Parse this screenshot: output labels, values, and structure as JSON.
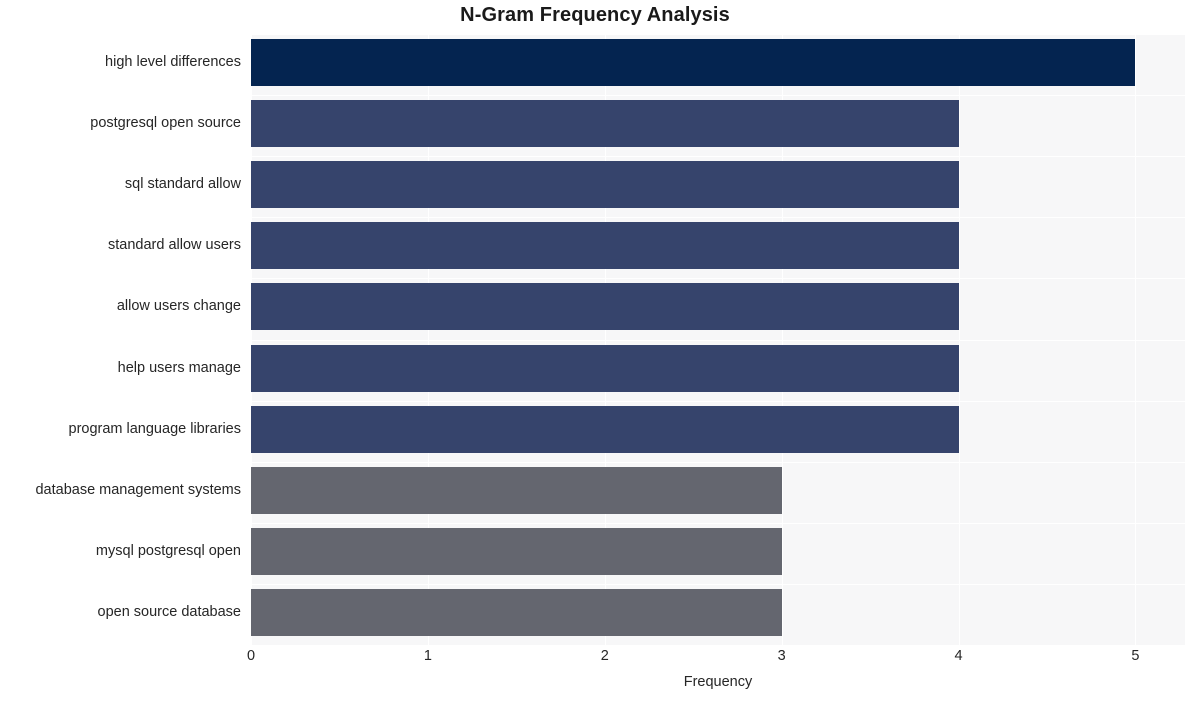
{
  "chart_data": {
    "type": "bar",
    "orientation": "horizontal",
    "title": "N-Gram Frequency Analysis",
    "xlabel": "Frequency",
    "ylabel": "",
    "categories": [
      "high level differences",
      "postgresql open source",
      "sql standard allow",
      "standard allow users",
      "allow users change",
      "help users manage",
      "program language libraries",
      "database management systems",
      "mysql postgresql open",
      "open source database"
    ],
    "values": [
      5,
      4,
      4,
      4,
      4,
      4,
      4,
      3,
      3,
      3
    ],
    "bar_colors": [
      "#042450",
      "#36446c",
      "#36446c",
      "#36446c",
      "#36446c",
      "#36446c",
      "#36446c",
      "#64666f",
      "#64666f",
      "#64666f"
    ],
    "xticks": [
      "0",
      "1",
      "2",
      "3",
      "4",
      "5"
    ],
    "xtick_values": [
      0,
      1,
      2,
      3,
      4,
      5
    ],
    "xlim": [
      0,
      5.28
    ],
    "grid": true,
    "grid_color": "#ffffff",
    "legend": null,
    "plot_background": "#f7f7f8",
    "figure_background": "#ffffff"
  }
}
